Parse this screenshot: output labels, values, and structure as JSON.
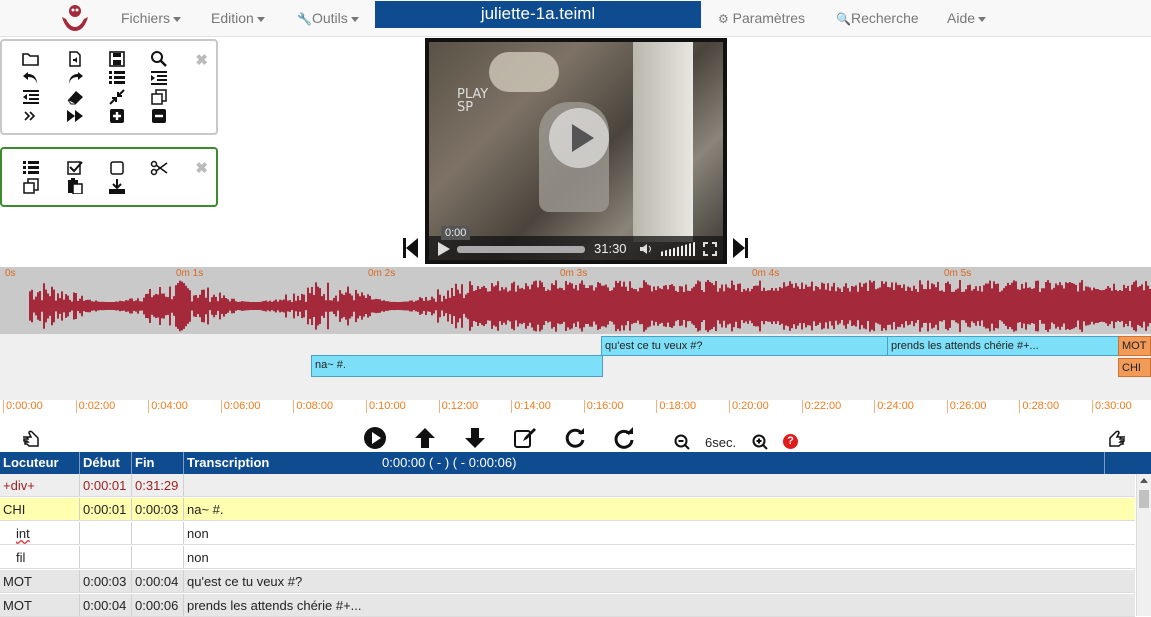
{
  "navbar": {
    "menus": [
      {
        "label": "Fichiers"
      },
      {
        "label": "Edition"
      },
      {
        "label": "Outils"
      },
      {
        "label": "Paramètres"
      },
      {
        "label": "Recherche"
      },
      {
        "label": "Aide"
      }
    ],
    "file_title": "juliette-1a.teiml"
  },
  "video": {
    "osd_line1": "PLAY",
    "osd_line2": "SP",
    "current_time": "0:00",
    "duration": "31:30",
    "progress": 0.0
  },
  "waveform": {
    "labels": [
      "0s",
      "0m 1s",
      "0m 2s",
      "0m 3s",
      "0m 4s",
      "0m 5s"
    ]
  },
  "segments": {
    "upper": [
      {
        "text": "qu'est ce tu veux #?",
        "color": "#7ee0f8"
      },
      {
        "text": "prends les attends chérie #+...",
        "color": "#7ee0f8"
      },
      {
        "text": "MOT",
        "color": "#f29a58"
      }
    ],
    "lower": [
      {
        "text": "na~ #.",
        "color": "#7ee0f8"
      },
      {
        "text": "CHI",
        "color": "#f29a58"
      }
    ]
  },
  "ruler": {
    "ticks": [
      "0:00:00",
      "0:02:00",
      "0:04:00",
      "0:06:00",
      "0:08:00",
      "0:10:00",
      "0:12:00",
      "0:14:00",
      "0:16:00",
      "0:18:00",
      "0:20:00",
      "0:22:00",
      "0:24:00",
      "0:26:00",
      "0:28:00",
      "0:30:00"
    ]
  },
  "zoom": {
    "label": "6sec."
  },
  "table": {
    "headers": {
      "speaker": "Locuteur",
      "start": "Début",
      "end": "Fin",
      "transcription": "Transcription"
    },
    "current_time": "0:00:00 ( - )  ( - 0:00:06)",
    "rows": [
      {
        "speaker": "+div+",
        "start": "0:00:01",
        "end": "0:31:29",
        "text": ""
      },
      {
        "speaker": "CHI",
        "start": "0:00:01",
        "end": "0:00:03",
        "text": "na~ #."
      },
      {
        "speaker": "int",
        "start": "",
        "end": "",
        "text": "non"
      },
      {
        "speaker": "fil",
        "start": "",
        "end": "",
        "text": "non"
      },
      {
        "speaker": "MOT",
        "start": "0:00:03",
        "end": "0:00:04",
        "text": "qu'est ce tu veux #?"
      },
      {
        "speaker": "MOT",
        "start": "0:00:04",
        "end": "0:00:06",
        "text": "prends les attends chérie #+..."
      }
    ]
  },
  "colors": {
    "accent": "#0e4c8f",
    "wave": "#a3293b",
    "segment": "#7ee0f8",
    "segment_alt": "#f29a58",
    "ruler": "#f07b1c",
    "chi_row": "#ffffb0",
    "panel2_border": "#3d8b2f"
  }
}
